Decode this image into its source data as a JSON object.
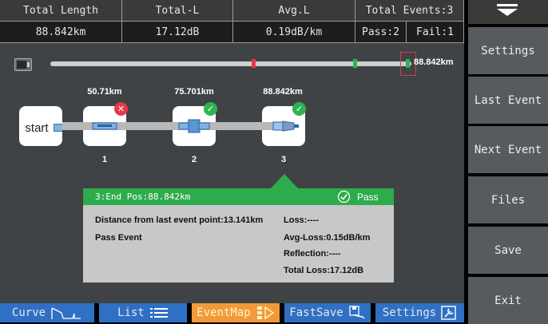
{
  "stats": {
    "headers": [
      "Total Length",
      "Total-L",
      "Avg.L",
      "Total Events:3"
    ],
    "values": [
      "88.842km",
      "17.12dB",
      "0.19dB/km"
    ],
    "pass": "Pass:2",
    "fail": "Fail:1"
  },
  "overview": {
    "total_distance": "88.842km"
  },
  "eventmap": {
    "start_label": "start",
    "events": [
      {
        "index": "1",
        "distance": "50.71km",
        "status": "fail",
        "badge_icon": "cross",
        "device_icon": "splice-icon"
      },
      {
        "index": "2",
        "distance": "75.701km",
        "status": "pass",
        "badge_icon": "check",
        "device_icon": "connector-icon"
      },
      {
        "index": "3",
        "distance": "88.842km",
        "status": "pass",
        "badge_icon": "check",
        "device_icon": "fiber-end-icon"
      }
    ]
  },
  "detail": {
    "title": "3:End  Pos:88.842km",
    "status": "Pass",
    "distance_from_last": "Distance from last event point:13.141km",
    "event_result": "Pass Event",
    "loss": "Loss:----",
    "avg_loss": "Avg-Loss:0.15dB/km",
    "reflection": "Reflection:----",
    "total_loss": "Total Loss:17.12dB"
  },
  "tabs": [
    {
      "label": "Curve",
      "icon": "curve-icon"
    },
    {
      "label": "List",
      "icon": "list-icon"
    },
    {
      "label": "EventMap",
      "icon": "eventmap-icon",
      "active": true
    },
    {
      "label": "FastSave",
      "icon": "fastsave-icon"
    },
    {
      "label": "Settings",
      "icon": "settings-icon"
    }
  ],
  "sidebar": {
    "buttons": [
      "Settings",
      "Last Event",
      "Next Event",
      "Files",
      "Save",
      "Exit"
    ]
  },
  "colors": {
    "pass": "#2fb352",
    "fail": "#e63946",
    "active_tab": "#f29a3a",
    "tab": "#2f70c4"
  }
}
